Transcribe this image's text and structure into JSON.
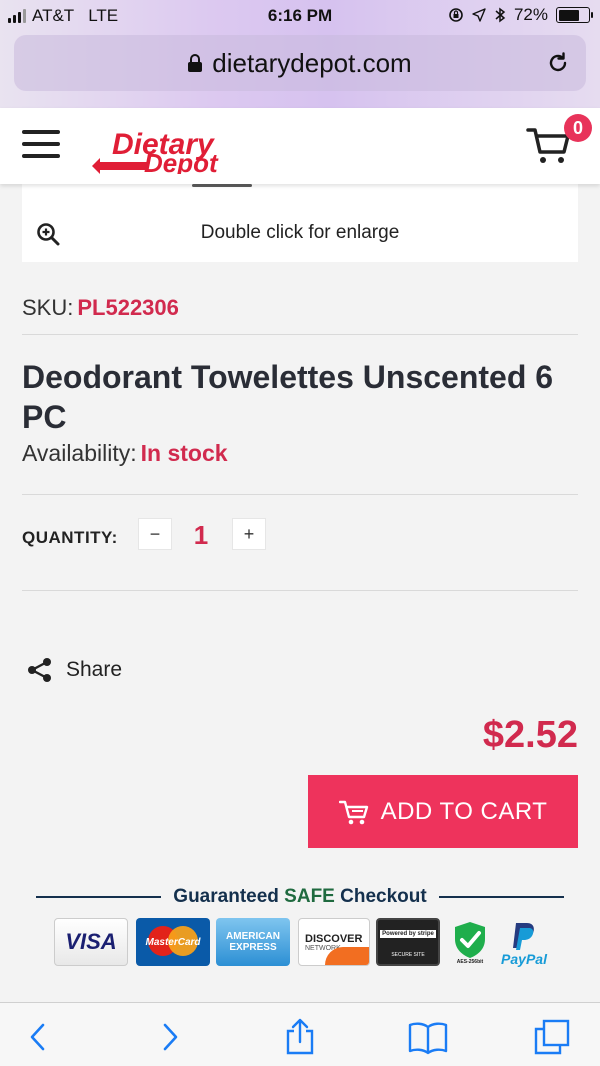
{
  "status_bar": {
    "carrier": "AT&T",
    "network": "LTE",
    "time": "6:16 PM",
    "battery": "72%"
  },
  "browser": {
    "url": "dietarydepot.com"
  },
  "header": {
    "logo_text_1": "Dietary",
    "logo_text_2": "Depot",
    "cart_count": "0"
  },
  "product_image": {
    "enlarge_hint": "Double click for enlarge"
  },
  "product": {
    "sku_label": "SKU:",
    "sku_value": "PL522306",
    "title": "Deodorant Towelettes Unscented 6 PC",
    "availability_label": "Availability:",
    "availability_value": "In stock",
    "quantity_label": "QUANTITY:",
    "quantity_minus": "−",
    "quantity_value": "1",
    "quantity_plus": "+",
    "share_label": "Share",
    "price": "$2.52",
    "add_to_cart_label": "ADD TO CART"
  },
  "checkout_badge": {
    "text_prefix": "Guaranteed",
    "text_highlight": "SAFE",
    "text_suffix": "Checkout"
  },
  "payment_badges": {
    "visa": "VISA",
    "mastercard": "MasterCard",
    "amex_1": "AMERICAN",
    "amex_2": "EXPRESS",
    "discover_1": "DISCOVER",
    "discover_2": "NETWORK",
    "stripe_1": "Powered by stripe",
    "stripe_2": "SECURE SITE",
    "aes": "AES-256bit",
    "paypal": "PayPal"
  },
  "colors": {
    "accent": "#d12a4e",
    "button": "#ee335c",
    "navy": "#14304d"
  }
}
